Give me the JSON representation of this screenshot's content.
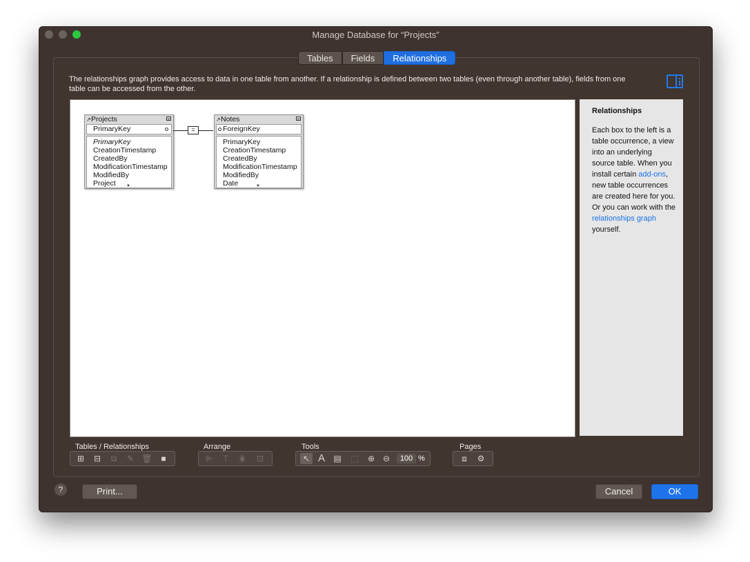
{
  "window": {
    "title": "Manage Database for “Projects”"
  },
  "tabs": [
    {
      "label": "Tables",
      "active": false
    },
    {
      "label": "Fields",
      "active": false
    },
    {
      "label": "Relationships",
      "active": true
    }
  ],
  "description": "The relationships graph provides access to data in one table from another. If a relationship is defined between two tables (even through another table), fields from one table can be accessed from the other.",
  "graph": {
    "tables": [
      {
        "name": "Projects",
        "key_field": "PrimaryKey",
        "fields": [
          "PrimaryKey",
          "CreationTimestamp",
          "CreatedBy",
          "ModificationTimestamp",
          "ModifiedBy",
          "Project"
        ]
      },
      {
        "name": "Notes",
        "key_field": "ForeignKey",
        "fields": [
          "PrimaryKey",
          "CreationTimestamp",
          "CreatedBy",
          "ModificationTimestamp",
          "ModifiedBy",
          "Date"
        ]
      }
    ],
    "relationship_operator": "="
  },
  "sidebar": {
    "title": "Relationships",
    "text_1": "Each box to the left is a table occurrence, a view into an underlying source table. When you install certain ",
    "link_1": "add-ons",
    "text_2": ", new table occurrences are created here for you. Or you can work with the ",
    "link_2": "relationships graph",
    "text_3": " yourself."
  },
  "toolbar": {
    "tables_label": "Tables / Relationships",
    "arrange_label": "Arrange",
    "tools_label": "Tools",
    "pages_label": "Pages",
    "zoom": "100",
    "zoom_unit": "%"
  },
  "buttons": {
    "help": "?",
    "print": "Print...",
    "cancel": "Cancel",
    "ok": "OK"
  },
  "colors": {
    "accent": "#1f73ea",
    "window_bg": "#3f332f"
  }
}
